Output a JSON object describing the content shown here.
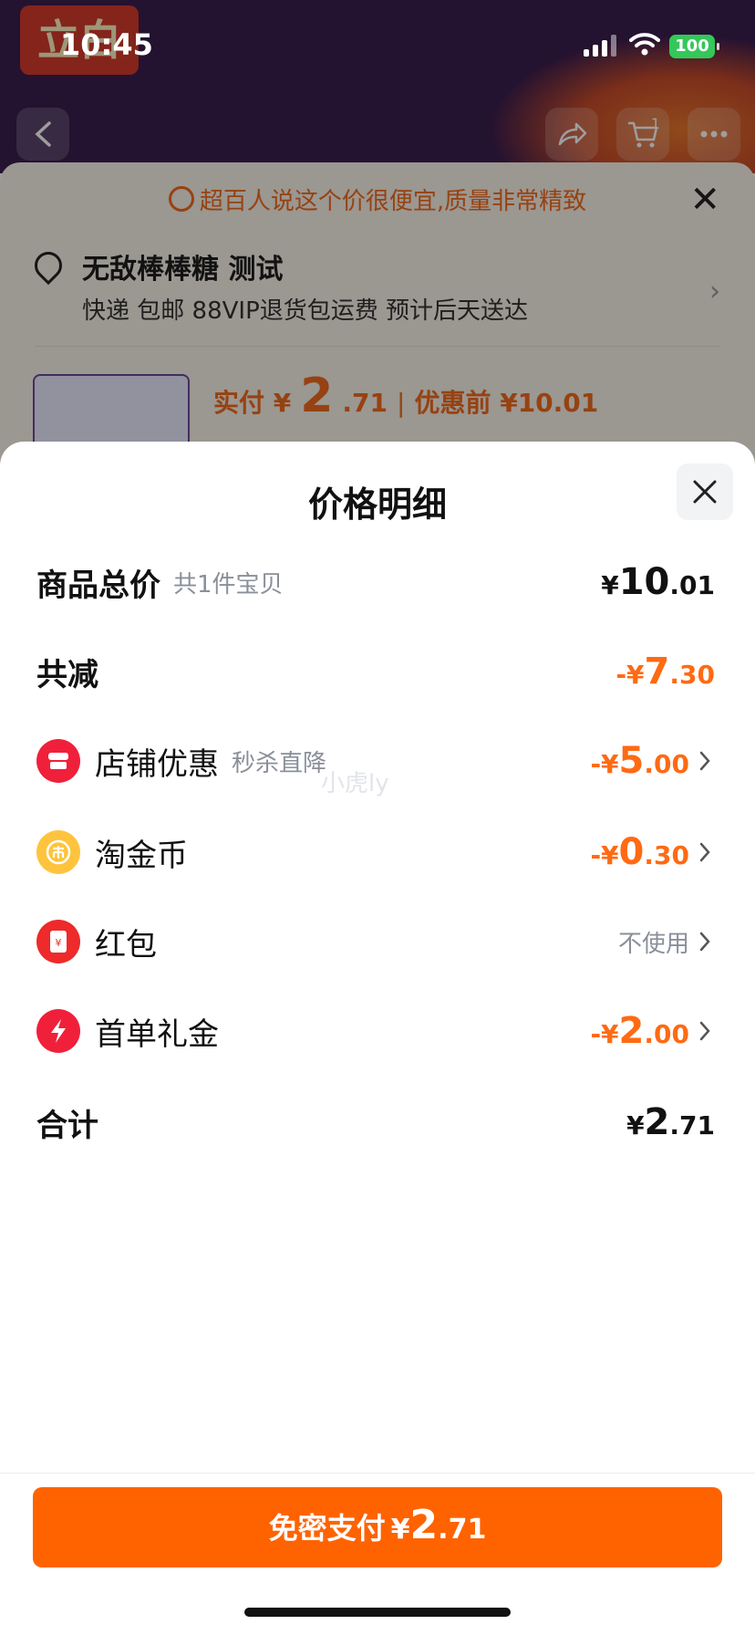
{
  "status_bar": {
    "time": "10:45",
    "battery": "100"
  },
  "background": {
    "logo_text": "立白",
    "cart_count": "1",
    "banner": "超百人说这个价很便宜,质量非常精致",
    "address_name": "无敌棒棒糖 测试",
    "shipping": "快递 包邮 88VIP退货包运费 预计后天送达",
    "paid_label": "实付 ¥",
    "paid_int": "2",
    "paid_dec": ".71",
    "before_label": "优惠前 ¥10.01"
  },
  "sheet": {
    "title": "价格明细",
    "total": {
      "label": "商品总价",
      "sub": "共1件宝贝",
      "cur": "¥",
      "int": "10",
      "dec": ".01"
    },
    "reduce": {
      "label": "共减",
      "cur": "-¥",
      "int": "7",
      "dec": ".30"
    },
    "items": [
      {
        "label": "店铺优惠",
        "sub": "秒杀直降",
        "cur": "-¥",
        "int": "5",
        "dec": ".00",
        "icon": "shop-icon"
      },
      {
        "label": "淘金币",
        "cur": "-¥",
        "int": "0",
        "dec": ".30",
        "icon": "coin-icon"
      },
      {
        "label": "红包",
        "value": "不使用",
        "icon": "red-packet-icon"
      },
      {
        "label": "首单礼金",
        "cur": "-¥",
        "int": "2",
        "dec": ".00",
        "icon": "bolt-icon"
      }
    ],
    "sum": {
      "label": "合计",
      "cur": "¥",
      "int": "2",
      "dec": ".71"
    },
    "watermark": "小虎ly"
  },
  "pay_button": {
    "label": "免密支付",
    "cur": "¥",
    "int": "2",
    "dec": ".71"
  },
  "colors": {
    "accent": "#ff6300",
    "discount": "#ff6a13"
  }
}
